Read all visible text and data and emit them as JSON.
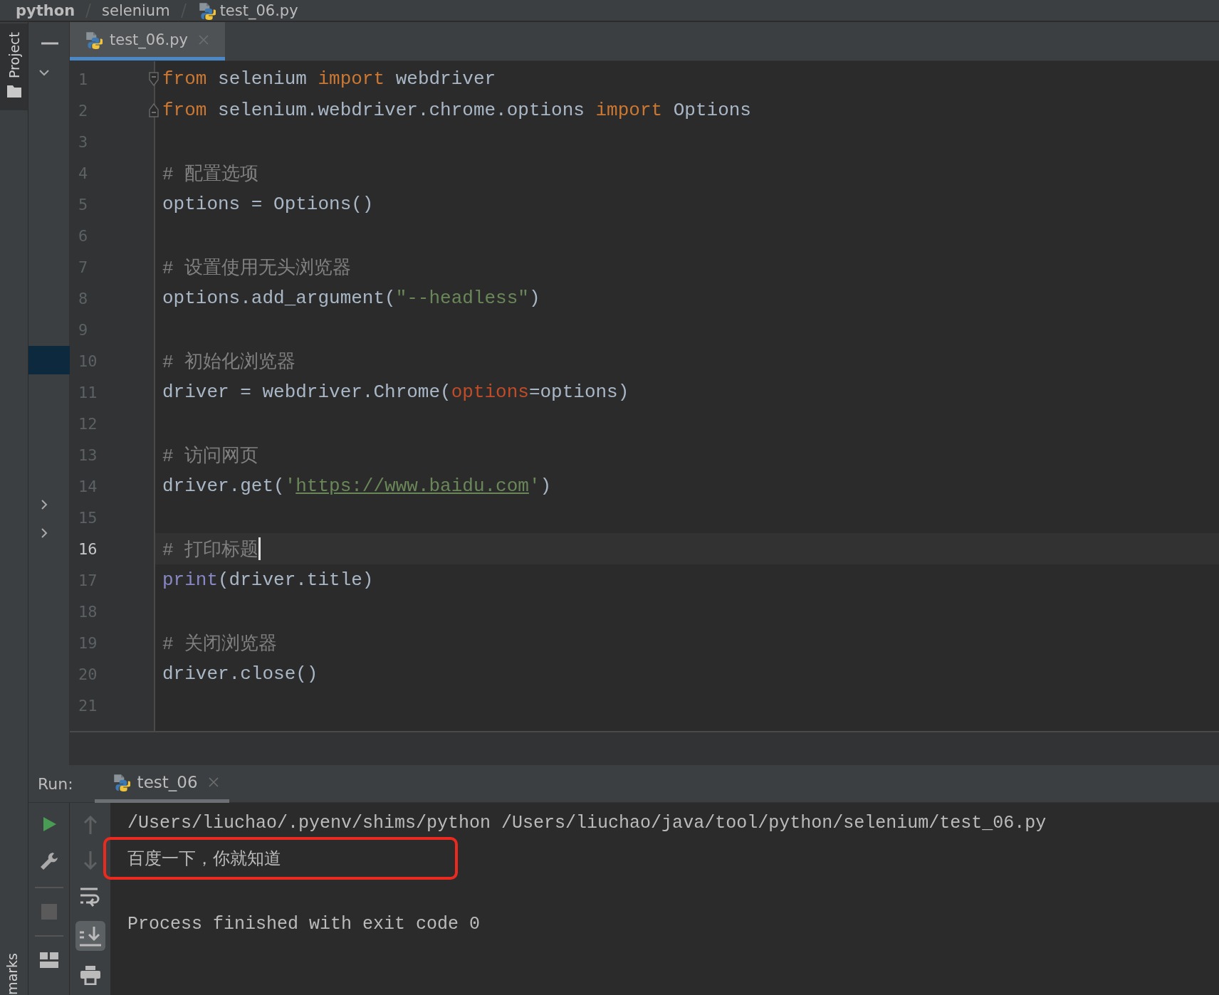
{
  "breadcrumb": [
    {
      "label": "python",
      "bold": true,
      "file": false
    },
    {
      "label": "selenium",
      "bold": false,
      "file": false
    },
    {
      "label": "test_06.py",
      "bold": false,
      "file": true
    }
  ],
  "tool_strip": {
    "top": "Project",
    "bottom": "marks"
  },
  "tabs": [
    {
      "label": "test_06.py",
      "selected": true
    }
  ],
  "code_lines": [
    {
      "number": "1",
      "current": false,
      "fold_start": true,
      "fold_end": false,
      "tokens": [
        {
          "kind": "keyword",
          "text": "from"
        },
        {
          "kind": "plain",
          "text": " selenium "
        },
        {
          "kind": "keyword",
          "text": "import"
        },
        {
          "kind": "plain",
          "text": " webdriver"
        }
      ]
    },
    {
      "number": "2",
      "current": false,
      "fold_start": false,
      "fold_end": true,
      "tokens": [
        {
          "kind": "keyword",
          "text": "from"
        },
        {
          "kind": "plain",
          "text": " selenium.webdriver.chrome.options "
        },
        {
          "kind": "keyword",
          "text": "import"
        },
        {
          "kind": "plain",
          "text": " Options"
        }
      ]
    },
    {
      "number": "3",
      "current": false,
      "fold_start": false,
      "fold_end": false
    },
    {
      "number": "4",
      "current": false,
      "fold_start": false,
      "fold_end": false,
      "tokens": [
        {
          "kind": "comment",
          "text": "# 配置选项"
        }
      ]
    },
    {
      "number": "5",
      "current": false,
      "fold_start": false,
      "fold_end": false,
      "tokens": [
        {
          "kind": "plain",
          "text": "options = Options()"
        }
      ]
    },
    {
      "number": "6",
      "current": false,
      "fold_start": false,
      "fold_end": false
    },
    {
      "number": "7",
      "current": false,
      "fold_start": false,
      "fold_end": false,
      "tokens": [
        {
          "kind": "comment",
          "text": "# 设置使用无头浏览器"
        }
      ]
    },
    {
      "number": "8",
      "current": false,
      "fold_start": false,
      "fold_end": false,
      "tokens": [
        {
          "kind": "plain",
          "text": "options.add_argument("
        },
        {
          "kind": "string",
          "text": "\"--headless\""
        },
        {
          "kind": "plain",
          "text": ")"
        }
      ]
    },
    {
      "number": "9",
      "current": false,
      "fold_start": false,
      "fold_end": false
    },
    {
      "number": "10",
      "current": false,
      "fold_start": false,
      "fold_end": false,
      "tokens": [
        {
          "kind": "comment",
          "text": "# 初始化浏览器"
        }
      ]
    },
    {
      "number": "11",
      "current": false,
      "fold_start": false,
      "fold_end": false,
      "tokens": [
        {
          "kind": "plain",
          "text": "driver = webdriver.Chrome("
        },
        {
          "kind": "param",
          "text": "options"
        },
        {
          "kind": "plain",
          "text": "=options)"
        }
      ]
    },
    {
      "number": "12",
      "current": false,
      "fold_start": false,
      "fold_end": false
    },
    {
      "number": "13",
      "current": false,
      "fold_start": false,
      "fold_end": false,
      "tokens": [
        {
          "kind": "comment",
          "text": "# 访问网页"
        }
      ]
    },
    {
      "number": "14",
      "current": false,
      "fold_start": false,
      "fold_end": false,
      "tokens": [
        {
          "kind": "plain",
          "text": "driver.get("
        },
        {
          "kind": "string",
          "text": "'"
        },
        {
          "kind": "link",
          "text": "https://www.baidu.com"
        },
        {
          "kind": "string",
          "text": "'"
        },
        {
          "kind": "plain",
          "text": ")"
        }
      ]
    },
    {
      "number": "15",
      "current": false,
      "fold_start": false,
      "fold_end": false
    },
    {
      "number": "16",
      "current": true,
      "fold_start": false,
      "fold_end": false,
      "tokens": [
        {
          "kind": "comment",
          "text": "# 打印标题"
        }
      ]
    },
    {
      "number": "17",
      "current": false,
      "fold_start": false,
      "fold_end": false,
      "tokens": [
        {
          "kind": "builtin",
          "text": "print"
        },
        {
          "kind": "plain",
          "text": "(driver.title)"
        }
      ]
    },
    {
      "number": "18",
      "current": false,
      "fold_start": false,
      "fold_end": false
    },
    {
      "number": "19",
      "current": false,
      "fold_start": false,
      "fold_end": false,
      "tokens": [
        {
          "kind": "comment",
          "text": "# 关闭浏览器"
        }
      ]
    },
    {
      "number": "20",
      "current": false,
      "fold_start": false,
      "fold_end": false,
      "tokens": [
        {
          "kind": "plain",
          "text": "driver.close()"
        }
      ]
    },
    {
      "number": "21",
      "current": false,
      "fold_start": false,
      "fold_end": false
    }
  ],
  "run_panel": {
    "label": "Run:",
    "tabs": [
      {
        "label": "test_06",
        "selected": true
      }
    ],
    "console": [
      {
        "text": "/Users/liuchao/.pyenv/shims/python /Users/liuchao/java/tool/python/selenium/test_06.py",
        "boxed": false
      },
      {
        "text": "百度一下，你就知道",
        "boxed": true
      },
      {
        "text": "Process finished with exit code 0",
        "boxed": false
      }
    ]
  }
}
